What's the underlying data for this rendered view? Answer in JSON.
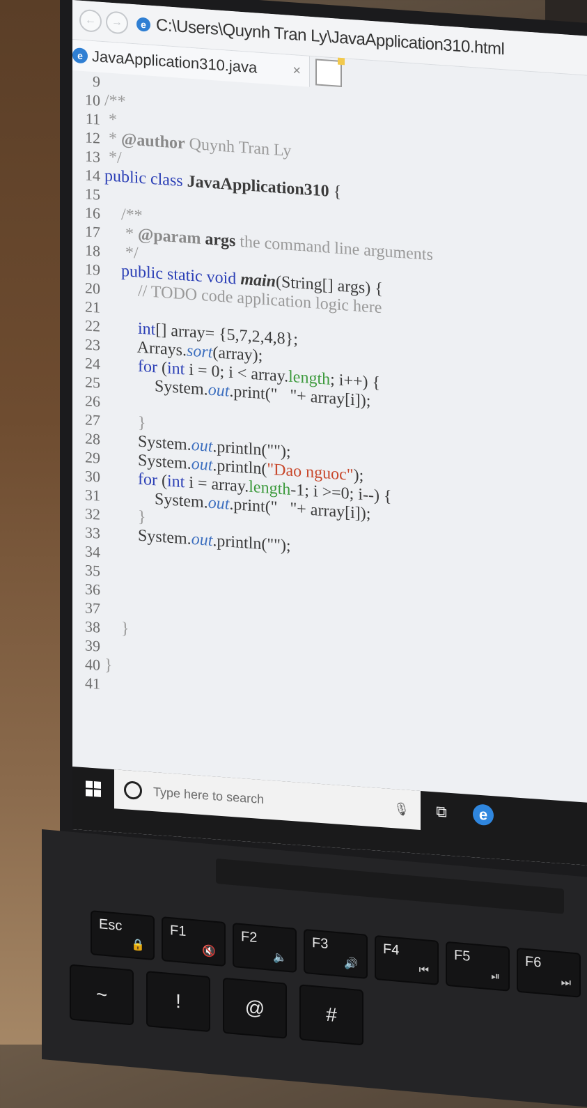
{
  "browser": {
    "address": "C:\\Users\\Quynh Tran Ly\\JavaApplication310.html",
    "tab_title": "JavaApplication310.java",
    "tab_close": "×",
    "back_label": "←",
    "forward_label": "→",
    "ie_logo": "e"
  },
  "code_lines": [
    {
      "n": "9",
      "parts": []
    },
    {
      "n": "10",
      "parts": [
        {
          "t": "/**",
          "c": "cm"
        }
      ]
    },
    {
      "n": "11",
      "parts": [
        {
          "t": " *",
          "c": "cm"
        }
      ]
    },
    {
      "n": "12",
      "parts": [
        {
          "t": " * ",
          "c": "cm"
        },
        {
          "t": "@author",
          "c": "an"
        },
        {
          "t": " Quynh Tran Ly",
          "c": "cm"
        }
      ]
    },
    {
      "n": "13",
      "parts": [
        {
          "t": " */",
          "c": "cm"
        }
      ]
    },
    {
      "n": "14",
      "parts": [
        {
          "t": "public class ",
          "c": "kw"
        },
        {
          "t": "JavaApplication310",
          "c": "b"
        },
        {
          "t": " {",
          "c": ""
        }
      ]
    },
    {
      "n": "15",
      "parts": []
    },
    {
      "n": "16",
      "parts": [
        {
          "t": "    /**",
          "c": "cm"
        }
      ]
    },
    {
      "n": "17",
      "parts": [
        {
          "t": "     * ",
          "c": "cm"
        },
        {
          "t": "@param",
          "c": "an"
        },
        {
          "t": " args",
          "c": "b"
        },
        {
          "t": " the command line arguments",
          "c": "cm"
        }
      ]
    },
    {
      "n": "18",
      "parts": [
        {
          "t": "     */",
          "c": "cm"
        }
      ]
    },
    {
      "n": "19",
      "parts": [
        {
          "t": "    public static void ",
          "c": "kw"
        },
        {
          "t": "main",
          "c": "bi"
        },
        {
          "t": "(String[] args) {",
          "c": ""
        }
      ]
    },
    {
      "n": "20",
      "parts": [
        {
          "t": "        // TODO code application logic here",
          "c": "cm"
        }
      ]
    },
    {
      "n": "21",
      "parts": []
    },
    {
      "n": "22",
      "parts": [
        {
          "t": "        int",
          "c": "kw"
        },
        {
          "t": "[] array= {5,7,2,4,8};",
          "c": ""
        }
      ]
    },
    {
      "n": "23",
      "parts": [
        {
          "t": "        Arrays.",
          "c": ""
        },
        {
          "t": "sort",
          "c": "it"
        },
        {
          "t": "(array);",
          "c": ""
        }
      ]
    },
    {
      "n": "24",
      "parts": [
        {
          "t": "        for",
          "c": "kw"
        },
        {
          "t": " (",
          "c": ""
        },
        {
          "t": "int",
          "c": "kw"
        },
        {
          "t": " i = 0; i < array.",
          "c": ""
        },
        {
          "t": "length",
          "c": "fld"
        },
        {
          "t": "; i++) {",
          "c": ""
        }
      ]
    },
    {
      "n": "25",
      "parts": [
        {
          "t": "            System.",
          "c": ""
        },
        {
          "t": "out",
          "c": "it"
        },
        {
          "t": ".print(\"   \"+ array[i]);",
          "c": ""
        }
      ]
    },
    {
      "n": "26",
      "parts": []
    },
    {
      "n": "27",
      "parts": [
        {
          "t": "        }",
          "c": "cm"
        }
      ]
    },
    {
      "n": "28",
      "parts": [
        {
          "t": "        System.",
          "c": ""
        },
        {
          "t": "out",
          "c": "it"
        },
        {
          "t": ".println(\"\");",
          "c": ""
        }
      ]
    },
    {
      "n": "29",
      "parts": [
        {
          "t": "        System.",
          "c": ""
        },
        {
          "t": "out",
          "c": "it"
        },
        {
          "t": ".println(",
          "c": ""
        },
        {
          "t": "\"Dao nguoc\"",
          "c": "str"
        },
        {
          "t": ");",
          "c": ""
        }
      ]
    },
    {
      "n": "30",
      "parts": [
        {
          "t": "        for",
          "c": "kw"
        },
        {
          "t": " (",
          "c": ""
        },
        {
          "t": "int",
          "c": "kw"
        },
        {
          "t": " i = array.",
          "c": ""
        },
        {
          "t": "length",
          "c": "fld"
        },
        {
          "t": "-1; i >=0; i--) {",
          "c": ""
        }
      ]
    },
    {
      "n": "31",
      "parts": [
        {
          "t": "            System.",
          "c": ""
        },
        {
          "t": "out",
          "c": "it"
        },
        {
          "t": ".print(\"   \"+ array[i]);",
          "c": ""
        }
      ]
    },
    {
      "n": "32",
      "parts": [
        {
          "t": "        }",
          "c": "cm"
        }
      ]
    },
    {
      "n": "33",
      "parts": [
        {
          "t": "        System.",
          "c": ""
        },
        {
          "t": "out",
          "c": "it"
        },
        {
          "t": ".println(\"\");",
          "c": ""
        }
      ]
    },
    {
      "n": "34",
      "parts": []
    },
    {
      "n": "35",
      "parts": []
    },
    {
      "n": "36",
      "parts": []
    },
    {
      "n": "37",
      "parts": []
    },
    {
      "n": "38",
      "parts": [
        {
          "t": "    }",
          "c": "cm"
        }
      ]
    },
    {
      "n": "39",
      "parts": []
    },
    {
      "n": "40",
      "parts": [
        {
          "t": "}",
          "c": "cm"
        }
      ]
    },
    {
      "n": "41",
      "parts": []
    }
  ],
  "taskbar": {
    "search_placeholder": "Type here to search",
    "mic_icon": "🎙",
    "task_view_icon": "⧉",
    "edge_label": "e"
  },
  "keyboard": {
    "esc": "Esc",
    "f1": "F1",
    "f1_sub": "🔇",
    "f2": "F2",
    "f2_sub": "🔈",
    "f3": "F3",
    "f3_sub": "🔊",
    "f4": "F4",
    "f4_sub": "⏮",
    "f5": "F5",
    "f5_sub": "⏯",
    "f6": "F6",
    "f6_sub": "⏭",
    "tilde": "~",
    "one": "!",
    "at": "@",
    "hash": "#"
  }
}
